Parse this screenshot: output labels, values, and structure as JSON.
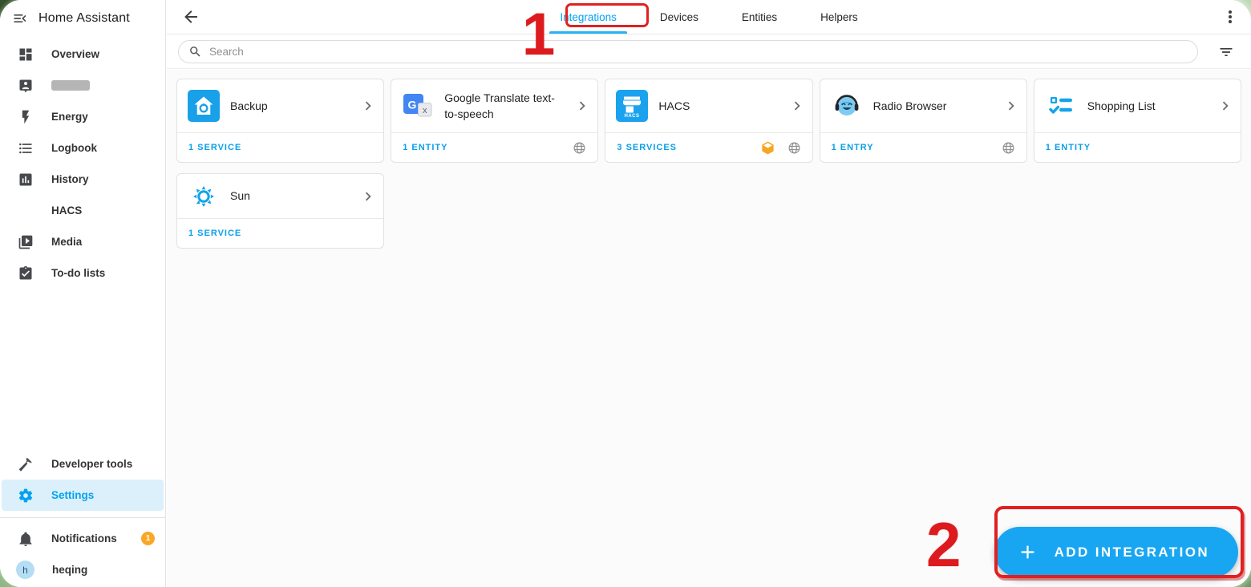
{
  "window": {
    "title": "Home Assistant"
  },
  "sidebar": {
    "items": [
      {
        "label": "Overview",
        "icon": "dashboard-icon"
      },
      {
        "label": "",
        "icon": "person-badge-icon",
        "redacted": true
      },
      {
        "label": "Energy",
        "icon": "lightning-icon"
      },
      {
        "label": "Logbook",
        "icon": "bulleted-list-icon"
      },
      {
        "label": "History",
        "icon": "chart-box-icon"
      },
      {
        "label": "HACS",
        "icon": ""
      },
      {
        "label": "Media",
        "icon": "media-play-icon"
      },
      {
        "label": "To-do lists",
        "icon": "clipboard-check-icon"
      },
      {
        "label": "Developer tools",
        "icon": "hammer-icon"
      },
      {
        "label": "Settings",
        "icon": "gear-icon",
        "active": true
      }
    ],
    "notifications": {
      "label": "Notifications",
      "badge": "1"
    },
    "user": {
      "name": "heqing",
      "initial": "h"
    }
  },
  "header": {
    "tabs": [
      {
        "label": "Integrations",
        "active": true
      },
      {
        "label": "Devices"
      },
      {
        "label": "Entities"
      },
      {
        "label": "Helpers"
      }
    ]
  },
  "search": {
    "placeholder": "Search"
  },
  "cards": [
    {
      "name": "Backup",
      "stat": "1 SERVICE",
      "footer_icons": []
    },
    {
      "name": "Google Translate text-to-speech",
      "stat": "1 ENTITY",
      "footer_icons": [
        "globe-icon"
      ]
    },
    {
      "name": "HACS",
      "stat": "3 SERVICES",
      "footer_icons": [
        "package-icon",
        "globe-icon"
      ]
    },
    {
      "name": "Radio Browser",
      "stat": "1 ENTRY",
      "footer_icons": [
        "globe-icon"
      ]
    },
    {
      "name": "Shopping List",
      "stat": "1 ENTITY",
      "footer_icons": []
    },
    {
      "name": "Sun",
      "stat": "1 SERVICE",
      "footer_icons": []
    }
  ],
  "fab": {
    "label": "ADD INTEGRATION"
  },
  "annotations": {
    "step1": "1",
    "step2": "2"
  },
  "colors": {
    "accent": "#04a2ef",
    "stat_blue": "#0aa0e8",
    "fab_blue": "#18a6f2",
    "annotation_red": "#e02021",
    "badge_orange": "#f9a825",
    "package_orange": "#f5a623",
    "active_item_bg": "#dcf0fb"
  }
}
